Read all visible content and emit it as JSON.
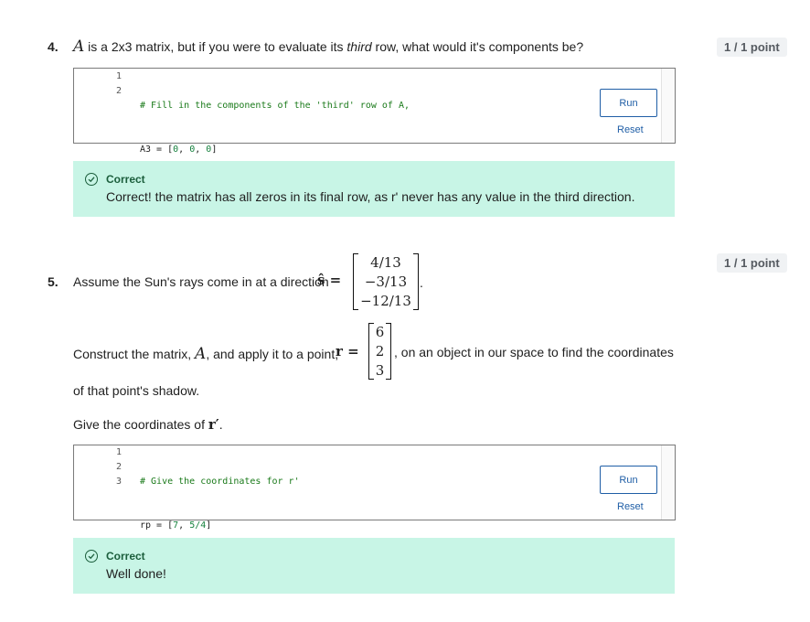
{
  "q4": {
    "number": "4.",
    "matrix_var": "A",
    "text_pre": " is a 2x3 matrix, but if you were to evaluate its ",
    "text_em": "third",
    "text_post": " row, what would it's components be?",
    "points": "1 / 1 point",
    "code": {
      "line_numbers": [
        "1",
        "2"
      ],
      "line1_comment": "# Fill in the components of the 'third' row of A,",
      "line2_prefix": "A3 = [",
      "line2_v1": "0",
      "line2_sep1": ", ",
      "line2_v2": "0",
      "line2_sep2": ", ",
      "line2_v3": "0",
      "line2_suffix": "]"
    },
    "run_label": "Run",
    "reset_label": "Reset",
    "feedback": {
      "title": "Correct",
      "body": "Correct! the matrix has all zeros in its final row, as r' never has any value in the third direction."
    }
  },
  "q5": {
    "number": "5.",
    "points": "1 / 1 point",
    "text_intro": "Assume the Sun's rays come in at a direction ",
    "s_symbol": "ŝ =",
    "s_vector": [
      "4/13",
      "−3/13",
      "−12/13"
    ],
    "s_end": ".",
    "construct_pre": "Construct the matrix, ",
    "construct_var": "A",
    "construct_mid": ", and apply it to a point, ",
    "r_symbol": "r =",
    "r_vector": [
      "6",
      "2",
      "3"
    ],
    "construct_post": ", on an object in our space to find the coordinates",
    "construct_line2": "of that point's shadow.",
    "give_pre": "Give the coordinates of ",
    "give_symbol": "r′",
    "give_end": ".",
    "code": {
      "line_numbers": [
        "1",
        "2",
        "3"
      ],
      "line1_comment": "# Give the coordinates for r'",
      "line2_prefix": "rp = [",
      "line2_v1": "7",
      "line2_sep": ", ",
      "line2_v2": "5/4",
      "line2_suffix": "]"
    },
    "run_label": "Run",
    "reset_label": "Reset",
    "feedback": {
      "title": "Correct",
      "body": "Well done!"
    }
  }
}
